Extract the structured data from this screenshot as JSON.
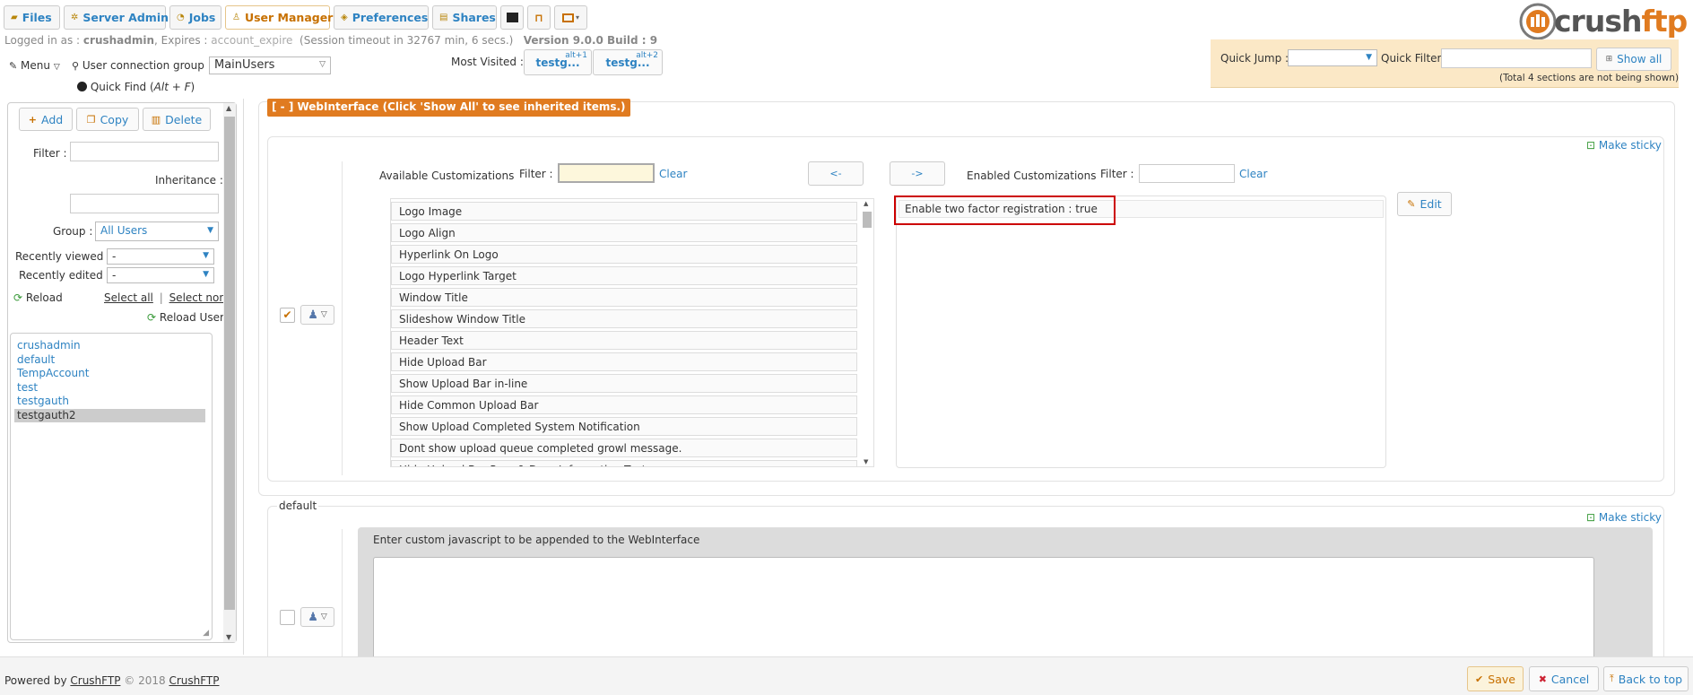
{
  "tabs": [
    {
      "label": "Files",
      "icon": "folder-icon"
    },
    {
      "label": "Server Admin",
      "icon": "gear-icon"
    },
    {
      "label": "Jobs",
      "icon": "jobs-icon"
    },
    {
      "label": "User Manager",
      "icon": "user-icon"
    },
    {
      "label": "Preferences",
      "icon": "preferences-icon"
    },
    {
      "label": "Shares",
      "icon": "shares-icon"
    }
  ],
  "logo": {
    "text_a": "crush",
    "text_b": "ftp"
  },
  "session": {
    "logged_in_label": "Logged in as :",
    "user": "crushadmin",
    "expires_label": ", Expires :",
    "expires_value": "account_expire",
    "timeout": "(Session timeout in 32767 min, 6 secs.)",
    "version": "Version 9.0.0 Build : 9"
  },
  "toolbar": {
    "menu": "Menu",
    "conn_group_label": "User connection group :",
    "conn_group_value": "MainUsers",
    "quick_find": "Quick Find (",
    "quick_find_key": "Alt + F",
    "quick_find_close": ")",
    "most_visited": "Most Visited :",
    "mv": [
      {
        "label": "testg...",
        "key": "alt+1"
      },
      {
        "label": "testg...",
        "key": "alt+2"
      }
    ]
  },
  "quick": {
    "jump_label": "Quick Jump :",
    "filter_label": "Quick Filter",
    "show_all": "Show all",
    "note": "(Total 4 sections are not being shown)"
  },
  "sidebar": {
    "add": "Add",
    "copy": "Copy",
    "delete": "Delete",
    "filter_label": "Filter :",
    "inheritance_label": "Inheritance :",
    "group_label": "Group :",
    "group_value": "All Users",
    "recent_viewed_label": "Recently viewed :",
    "recent_viewed_value": "-",
    "recent_edited_label": "Recently edited :",
    "recent_edited_value": "-",
    "reload": "Reload",
    "select_all": "Select all",
    "separator": "|",
    "select_none": "Select none",
    "reload_user": "Reload User",
    "users": [
      "crushadmin",
      "default",
      "TempAccount",
      "test",
      "testgauth",
      "testgauth2"
    ],
    "selected_user": "testgauth2"
  },
  "section": {
    "header": "[ - ] WebInterface (Click 'Show All' to see inherited items.)",
    "make_sticky": "Make sticky",
    "available_label": "Available Customizations",
    "filter_label": "Filter :",
    "clear": "Clear",
    "move_left": "<-",
    "move_right": "->",
    "enabled_label": "Enabled Customizations",
    "edit": "Edit",
    "available": [
      "Logo Image",
      "Logo Align",
      "Hyperlink On Logo",
      "Logo Hyperlink Target",
      "Window Title",
      "Slideshow Window Title",
      "Header Text",
      "Hide Upload Bar",
      "Show Upload Bar in-line",
      "Hide Common Upload Bar",
      "Show Upload Completed System Notification",
      "Dont show upload queue completed growl message.",
      "Hide Upload Bar Pass & Drag Information Text"
    ],
    "enabled": [
      "Enable two factor registration : true"
    ]
  },
  "default_section": {
    "legend": "default",
    "make_sticky": "Make sticky",
    "js_label": "Enter custom javascript to be appended to the WebInterface"
  },
  "footer": {
    "powered_by": "Powered by",
    "brand": "CrushFTP",
    "copyright": "© 2018",
    "brand2": "CrushFTP",
    "save": "Save",
    "cancel": "Cancel",
    "back_to_top": "Back to top"
  },
  "colors": {
    "accent": "#2e83c2",
    "orange": "#e07b20",
    "highlight_red": "#cc0000"
  }
}
